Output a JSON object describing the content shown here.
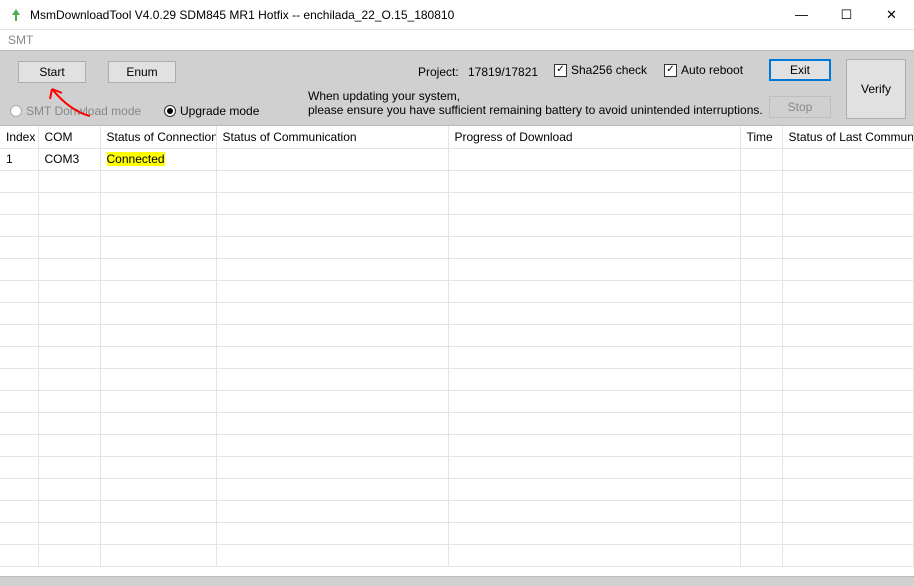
{
  "window": {
    "title": "MsmDownloadTool V4.0.29 SDM845 MR1 Hotfix -- enchilada_22_O.15_180810",
    "minimize": "—",
    "maximize": "☐",
    "close": "✕"
  },
  "menu": {
    "smt": "SMT"
  },
  "toolbar": {
    "start": "Start",
    "enum": "Enum",
    "exit": "Exit",
    "stop": "Stop",
    "verify": "Verify",
    "project_label": "Project:",
    "project_value": "17819/17821",
    "sha256_label": "Sha256 check",
    "auto_reboot_label": "Auto reboot",
    "info_line1": "When updating your system,",
    "info_line2": "please ensure you have sufficient remaining battery to avoid unintended interruptions.",
    "radio_smt": "SMT Donwload mode",
    "radio_upgrade": "Upgrade mode"
  },
  "table": {
    "headers": {
      "index": "Index",
      "com": "COM",
      "conn": "Status of Connection",
      "comm": "Status of Communication",
      "prog": "Progress of Download",
      "time": "Time",
      "last": "Status of Last Communication"
    },
    "rows": [
      {
        "index": "1",
        "com": "COM3",
        "conn": "Connected",
        "comm": "",
        "prog": "",
        "time": "",
        "last": ""
      }
    ]
  }
}
